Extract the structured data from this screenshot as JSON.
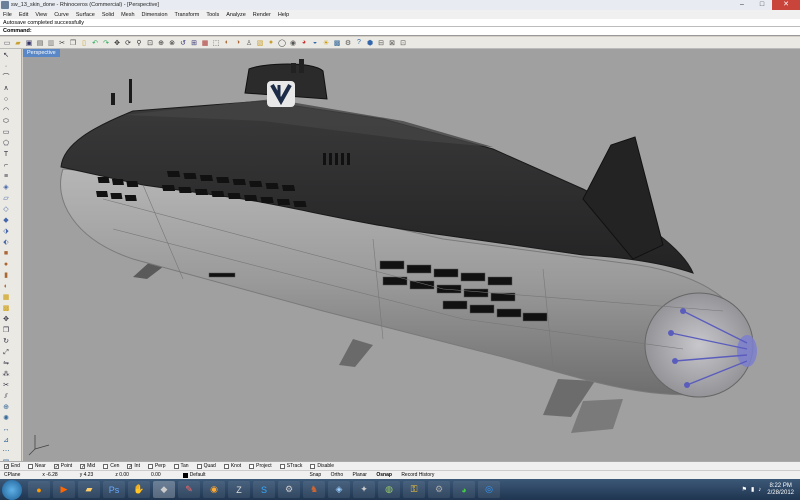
{
  "window": {
    "title": "sw_13_skin_done - Rhinoceros (Commercial) - [Perspective]"
  },
  "menu": [
    "File",
    "Edit",
    "View",
    "Curve",
    "Surface",
    "Solid",
    "Mesh",
    "Dimension",
    "Transform",
    "Tools",
    "Analyze",
    "Render",
    "Help"
  ],
  "command_history": "Autosave completed successfully",
  "command_prompt": "Command:",
  "viewport": {
    "label": "Perspective"
  },
  "osnaps": [
    {
      "label": "End",
      "checked": true
    },
    {
      "label": "Near",
      "checked": false
    },
    {
      "label": "Point",
      "checked": true
    },
    {
      "label": "Mid",
      "checked": true
    },
    {
      "label": "Cen",
      "checked": false
    },
    {
      "label": "Int",
      "checked": true
    },
    {
      "label": "Perp",
      "checked": false
    },
    {
      "label": "Tan",
      "checked": false
    },
    {
      "label": "Quad",
      "checked": false
    },
    {
      "label": "Knot",
      "checked": false
    },
    {
      "label": "Project",
      "checked": false
    },
    {
      "label": "STrack",
      "checked": false
    },
    {
      "label": "Disable",
      "checked": false
    }
  ],
  "status": {
    "cplane": "CPlane",
    "x": "x -6.28",
    "y": "y 4.23",
    "z": "z 0.00",
    "d": "0.00",
    "layer": "Default",
    "buttons": [
      "Snap",
      "Ortho",
      "Planar",
      "Osnap",
      "Record History"
    ]
  },
  "taskbar": {
    "icons": [
      "firefox-icon",
      "media-player-icon",
      "folder-icon",
      "photoshop-icon",
      "hand-icon",
      "rhino-icon",
      "paint-icon",
      "blender-icon",
      "zbrush-icon",
      "skype-icon",
      "settings-icon",
      "game-icon",
      "3d-icon",
      "utility-icon",
      "disk-icon",
      "lock-icon",
      "steam-icon",
      "chrome-icon",
      "app-icon",
      "media-icon"
    ],
    "time": "8:22 PM",
    "date": "2/28/2012"
  },
  "colors": {
    "viewport_bg": "#a0a0a0",
    "hull_dark": "#2f2f30",
    "hull_grey": "#9a9a9a",
    "tab_blue": "#5a87c6"
  }
}
